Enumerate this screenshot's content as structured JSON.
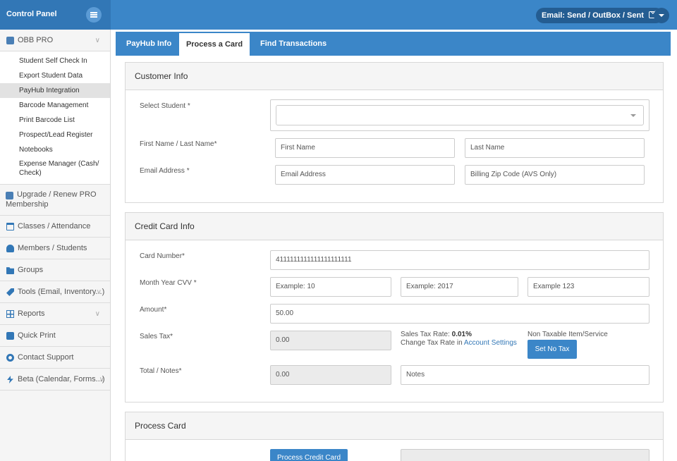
{
  "header": {
    "brand_title": "Control Panel",
    "email_label": "Email: Send / OutBox / Sent"
  },
  "sidebar": {
    "obb_pro": "OBB PRO",
    "sub_items": [
      "Student Self Check In",
      "Export Student Data",
      "PayHub Integration",
      "Barcode Management",
      "Print Barcode List",
      "Prospect/Lead Register",
      "Notebooks",
      "Expense Manager (Cash/ Check)"
    ],
    "upgrade": "Upgrade / Renew PRO",
    "upgrade_line2": "Membership",
    "items": [
      "Classes / Attendance",
      "Members / Students",
      "Groups",
      "Tools (Email, Inventory...)",
      "Reports",
      "Quick Print",
      "Contact Support",
      "Beta (Calendar, Forms...)"
    ]
  },
  "tabs": [
    "PayHub Info",
    "Process a Card",
    "Find Transactions"
  ],
  "customer": {
    "title": "Customer Info",
    "select_student_label": "Select Student *",
    "name_label": "First Name / Last Name*",
    "first_name_placeholder": "First Name",
    "last_name_placeholder": "Last Name",
    "email_label": "Email Address *",
    "email_placeholder": "Email Address",
    "zip_placeholder": "Billing Zip Code (AVS Only)"
  },
  "credit": {
    "title": "Credit Card Info",
    "card_number_label": "Card Number*",
    "card_number_value": "4111111111111111111111",
    "month_year_label": "Month Year CVV *",
    "month_placeholder": "Example: 10",
    "year_placeholder": "Example: 2017",
    "cvv_placeholder": "Example 123",
    "amount_label": "Amount*",
    "amount_value": "50.00",
    "sales_tax_label": "Sales Tax*",
    "sales_tax_value": "0.00",
    "tax_rate_prefix": "Sales Tax Rate:",
    "tax_rate_value": "0.01%",
    "change_tax_text": "Change Tax Rate in",
    "account_settings_link": "Account Settings",
    "non_taxable_label": "Non Taxable Item/Service",
    "set_no_tax_button": "Set No Tax",
    "total_label": "Total / Notes*",
    "total_value": "0.00",
    "notes_placeholder": "Notes"
  },
  "process": {
    "title": "Process Card",
    "button": "Process Credit Card"
  }
}
